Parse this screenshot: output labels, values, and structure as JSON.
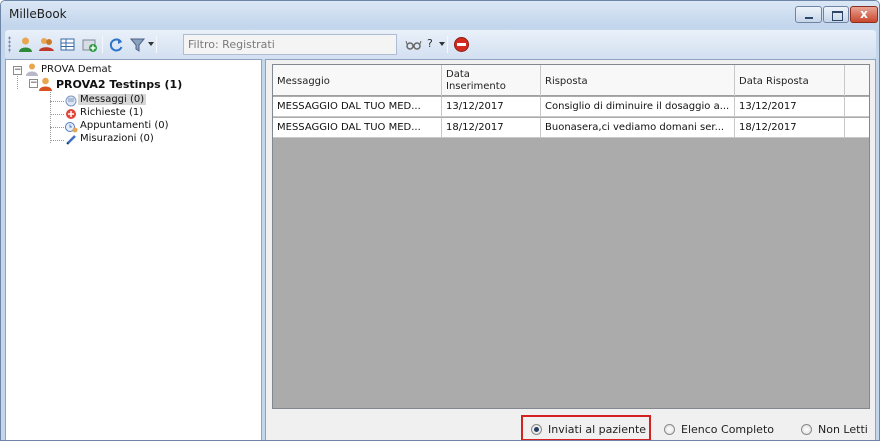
{
  "window": {
    "title": "MilleBook",
    "close_glyph": "x"
  },
  "toolbar": {
    "icons": [
      "user-icon",
      "users-icon",
      "grid-icon",
      "add-record-icon",
      "refresh-icon",
      "filter-icon",
      "glasses-icon",
      "help-icon",
      "stop-icon"
    ],
    "filter_text": "Filtro: Registrati",
    "help_label": "?"
  },
  "tree": {
    "root": "PROVA Demat",
    "patient": "PROVA2 Testinps (1)",
    "children": [
      "Messaggi (0)",
      "Richieste (1)",
      "Appuntamenti (0)",
      "Misurazioni (0)"
    ]
  },
  "grid": {
    "columns": [
      "Messaggio",
      "Data Inserimento",
      "Risposta",
      "Data Risposta"
    ],
    "column_line2": {
      "data_inserimento_1": "Data",
      "data_inserimento_2": "Inserimento"
    },
    "rows": [
      [
        "MESSAGGIO DAL TUO MED...",
        "13/12/2017",
        "Consiglio di diminuire il dosaggio a...",
        "13/12/2017"
      ],
      [
        "MESSAGGIO DAL TUO MED...",
        "18/12/2017",
        "Buonasera,ci vediamo domani ser...",
        "18/12/2017"
      ]
    ]
  },
  "view_options": {
    "options": [
      "Inviati al paziente",
      "Elenco Completo",
      "Non Letti"
    ],
    "selected": "Inviati al paziente",
    "highlight_color": "#d42121"
  },
  "colors": {
    "accent": "#243e67",
    "grid_background": "#ababab",
    "window_frame": "#c4d6ec"
  }
}
